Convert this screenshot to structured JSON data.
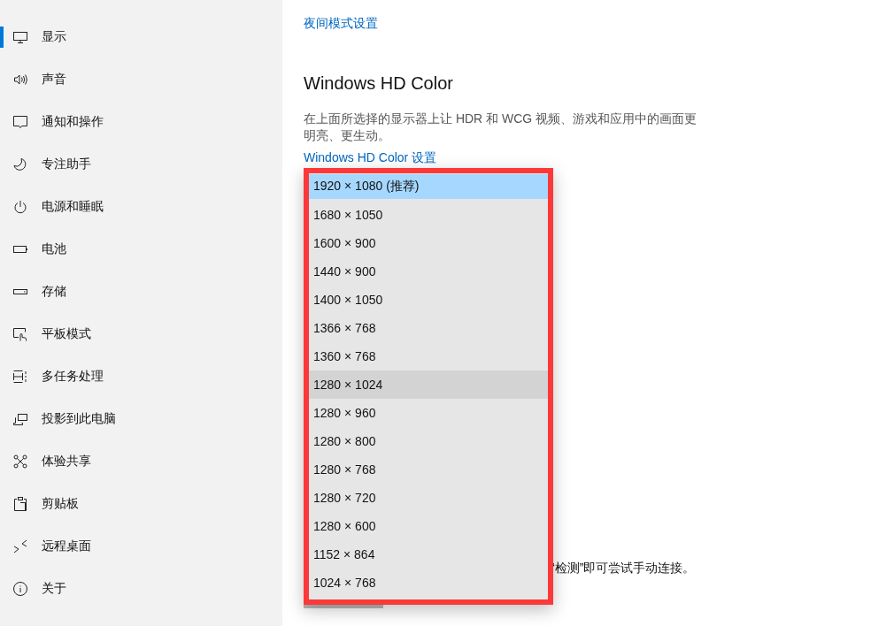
{
  "sidebar": {
    "items": [
      {
        "label": "显示",
        "selected": true
      },
      {
        "label": "声音",
        "selected": false
      },
      {
        "label": "通知和操作",
        "selected": false
      },
      {
        "label": "专注助手",
        "selected": false
      },
      {
        "label": "电源和睡眠",
        "selected": false
      },
      {
        "label": "电池",
        "selected": false
      },
      {
        "label": "存储",
        "selected": false
      },
      {
        "label": "平板模式",
        "selected": false
      },
      {
        "label": "多任务处理",
        "selected": false
      },
      {
        "label": "投影到此电脑",
        "selected": false
      },
      {
        "label": "体验共享",
        "selected": false
      },
      {
        "label": "剪贴板",
        "selected": false
      },
      {
        "label": "远程桌面",
        "selected": false
      },
      {
        "label": "关于",
        "selected": false
      }
    ]
  },
  "main": {
    "night_link": "夜间模式设置",
    "heading": "Windows HD Color",
    "description": "在上面所选择的显示器上让 HDR 和 WCG 视频、游戏和应用中的画面更明亮、更生动。",
    "hd_link": "Windows HD Color 设置",
    "detect_hint": "“检测”即可尝试手动连接。"
  },
  "dropdown": {
    "options": [
      {
        "label": "1920 × 1080 (推荐)",
        "selected": true,
        "hovered": false
      },
      {
        "label": "1680 × 1050",
        "selected": false,
        "hovered": false
      },
      {
        "label": "1600 × 900",
        "selected": false,
        "hovered": false
      },
      {
        "label": "1440 × 900",
        "selected": false,
        "hovered": false
      },
      {
        "label": "1400 × 1050",
        "selected": false,
        "hovered": false
      },
      {
        "label": "1366 × 768",
        "selected": false,
        "hovered": false
      },
      {
        "label": "1360 × 768",
        "selected": false,
        "hovered": false
      },
      {
        "label": "1280 × 1024",
        "selected": false,
        "hovered": true
      },
      {
        "label": "1280 × 960",
        "selected": false,
        "hovered": false
      },
      {
        "label": "1280 × 800",
        "selected": false,
        "hovered": false
      },
      {
        "label": "1280 × 768",
        "selected": false,
        "hovered": false
      },
      {
        "label": "1280 × 720",
        "selected": false,
        "hovered": false
      },
      {
        "label": "1280 × 600",
        "selected": false,
        "hovered": false
      },
      {
        "label": "1152 × 864",
        "selected": false,
        "hovered": false
      },
      {
        "label": "1024 × 768",
        "selected": false,
        "hovered": false
      }
    ]
  }
}
